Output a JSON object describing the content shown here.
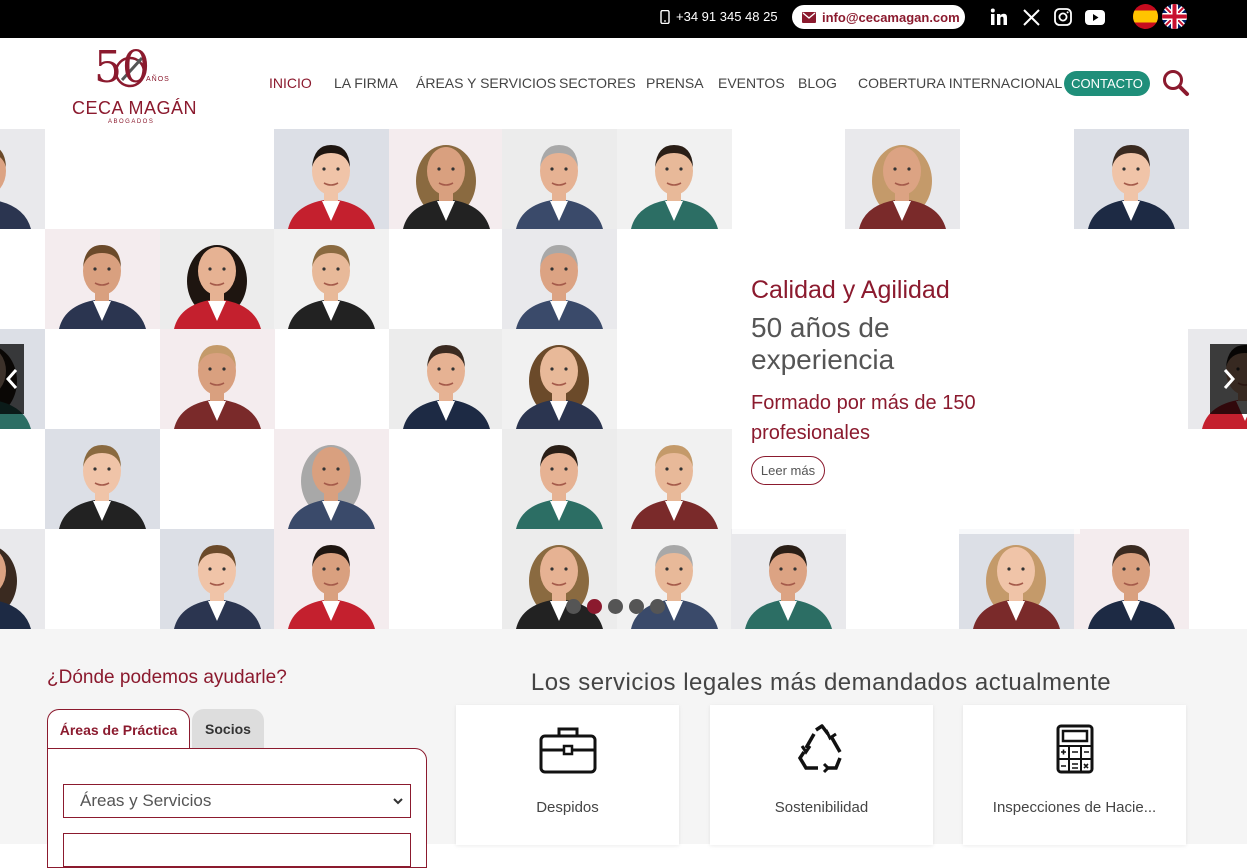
{
  "topbar": {
    "phone": "+34 91 345 48 25",
    "email": "info@cecamagan.com",
    "social": [
      "linkedin-icon",
      "x-icon",
      "instagram-icon",
      "youtube-icon"
    ],
    "languages": [
      "es",
      "en"
    ]
  },
  "logo": {
    "number": "50",
    "anos": "AÑOS",
    "name": "CECA MAGÁN",
    "sub": "ABOGADOS"
  },
  "nav": {
    "items": [
      "INICIO",
      "LA FIRMA",
      "ÁREAS Y SERVICIOS",
      "SECTORES",
      "PRENSA",
      "EVENTOS",
      "BLOG",
      "COBERTURA INTERNACIONAL"
    ],
    "active": "INICIO",
    "contact": "CONTACTO"
  },
  "hero": {
    "title": "Calidad y Agilidad",
    "subtitle": "50 años de experiencia",
    "description": "Formado por más de 150 profesionales",
    "button": "Leer más",
    "slides": 5,
    "active_slide": 2
  },
  "help": {
    "title": "¿Dónde podemos ayudarle?",
    "tabs": [
      "Áreas de Práctica",
      "Socios"
    ],
    "select_value": "Áreas y Servicios"
  },
  "services": {
    "title": "Los servicios legales más demandados actualmente",
    "cards": [
      {
        "label": "Despidos",
        "icon": "briefcase-icon"
      },
      {
        "label": "Sostenibilidad",
        "icon": "recycle-icon"
      },
      {
        "label": "Inspecciones de Hacie...",
        "icon": "calculator-icon"
      }
    ]
  },
  "colors": {
    "brand": "#8b1a2e",
    "accent": "#1f8f7a"
  }
}
